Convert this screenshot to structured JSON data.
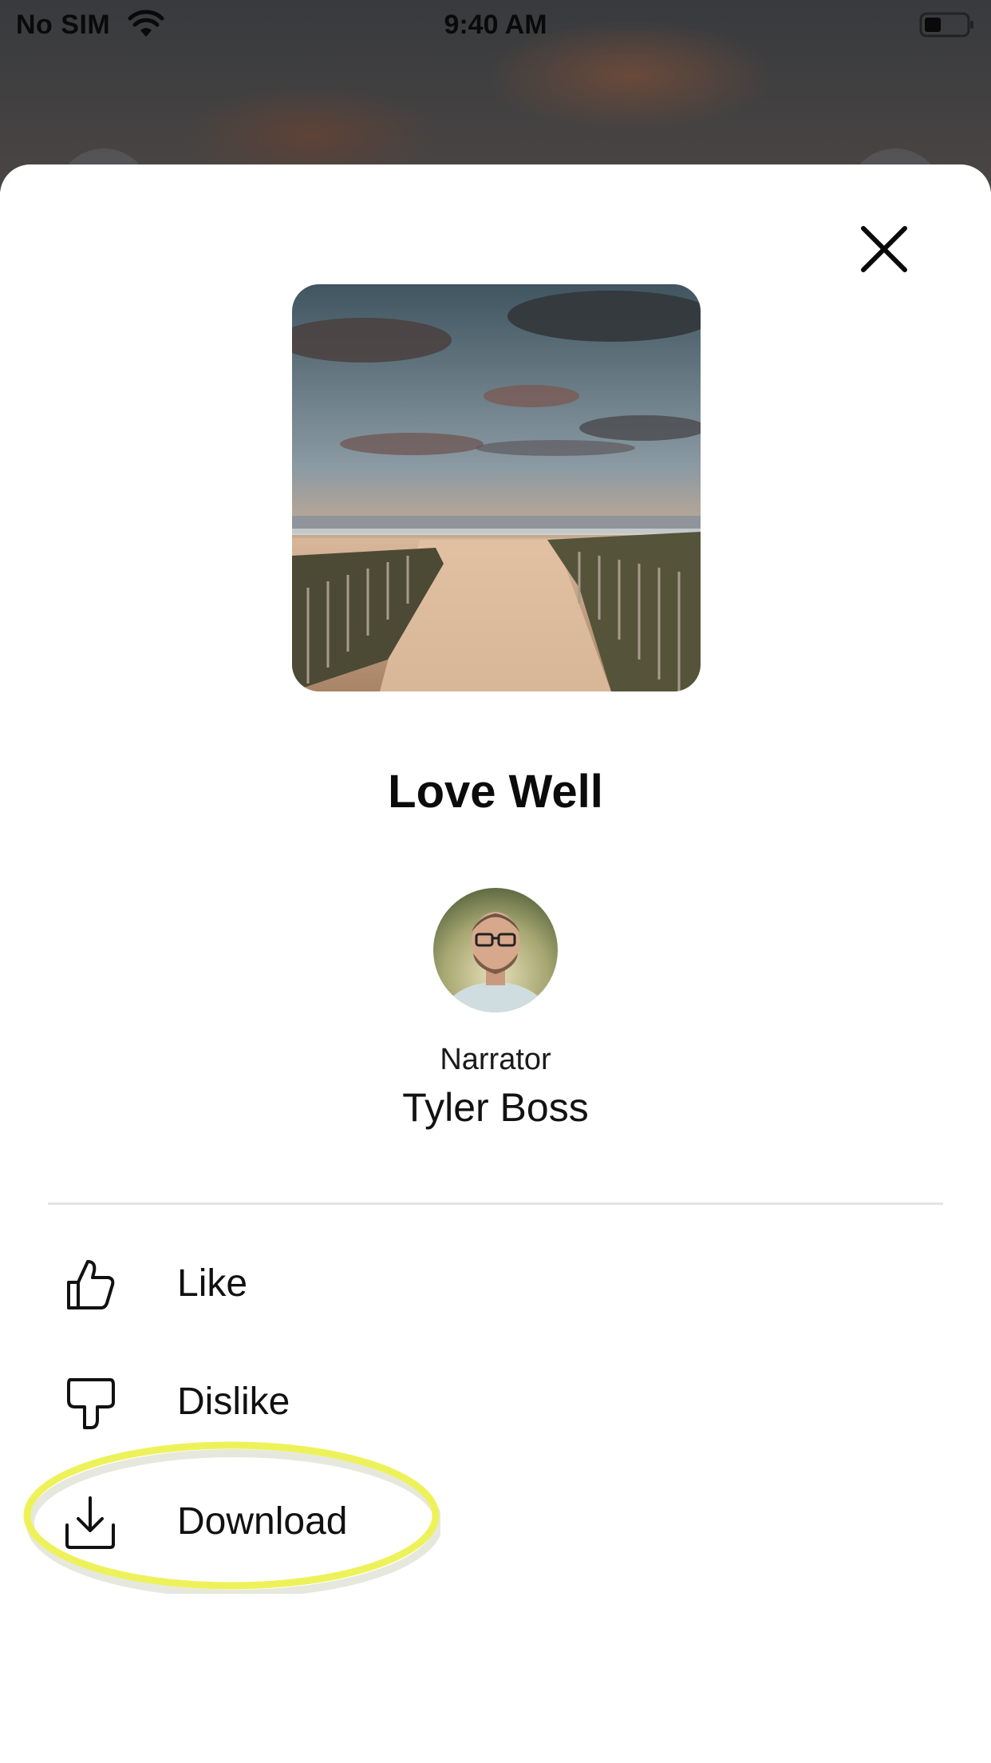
{
  "status_bar": {
    "carrier": "No SIM",
    "time": "9:40 AM",
    "wifi_icon": "wifi-icon",
    "battery_icon": "battery-icon"
  },
  "sheet": {
    "close_icon": "close-icon",
    "cover_image": "beach-path-sunset",
    "title": "Love Well",
    "narrator": {
      "label": "Narrator",
      "name": "Tyler Boss",
      "avatar": "narrator-avatar"
    },
    "menu": [
      {
        "label": "Like",
        "icon": "thumbs-up-icon"
      },
      {
        "label": "Dislike",
        "icon": "thumbs-down-icon"
      },
      {
        "label": "Download",
        "icon": "download-icon"
      }
    ],
    "highlight_color": "#eef25a"
  }
}
